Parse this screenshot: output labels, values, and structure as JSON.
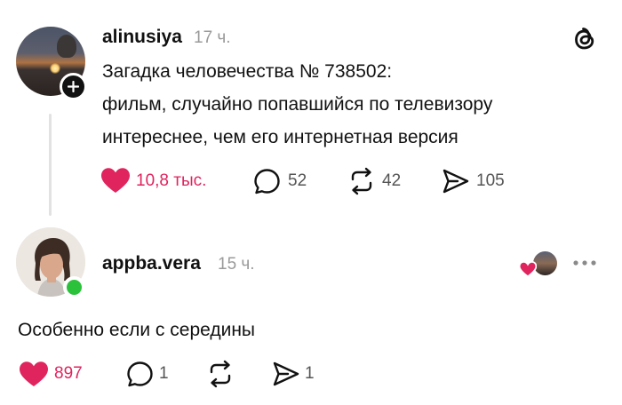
{
  "post1": {
    "username": "alinusiya",
    "time": "17 ч.",
    "lines": [
      "Загадка человечества № 738502:",
      "фильм, случайно попавшийся по телевизору",
      "интереснее, чем его интернетная версия"
    ],
    "likes": "10,8 тыс.",
    "replies": "52",
    "reposts": "42",
    "shares": "105"
  },
  "post2": {
    "username": "appba.vera",
    "time": "15 ч.",
    "text": "Особенно если с середины",
    "likes": "897",
    "replies": "1",
    "shares": "1"
  },
  "icons": {
    "heart": "heart-icon",
    "reply": "speech-bubble-icon",
    "repost": "repost-icon",
    "share": "send-icon",
    "logo": "threads-logo-icon",
    "more": "ellipsis-icon",
    "follow": "plus-icon"
  },
  "colors": {
    "like": "#e0245e",
    "online": "#2cc13b",
    "text": "#111111",
    "muted": "#9a9a9a"
  }
}
